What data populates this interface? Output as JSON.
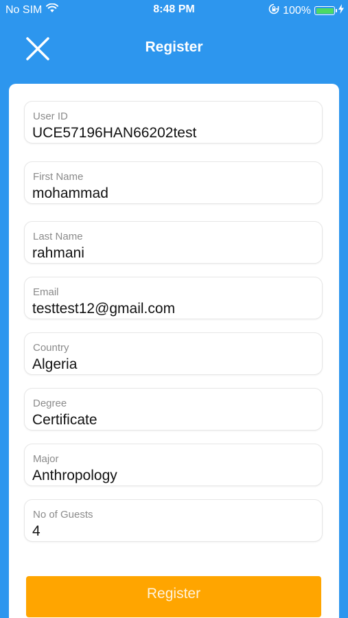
{
  "status_bar": {
    "carrier": "No SIM",
    "time": "8:48 PM",
    "battery_percent": "100%",
    "battery_level": 1.0,
    "battery_color": "#4cd964",
    "icons": [
      "wifi-icon",
      "rotation-lock-icon",
      "battery-icon",
      "charging-bolt-icon"
    ]
  },
  "nav": {
    "title": "Register",
    "close_icon": "close-icon",
    "background": "#2d96ee"
  },
  "form": {
    "fields": [
      {
        "label": "User ID",
        "value": "UCE57196HAN66202test"
      },
      {
        "label": "First Name",
        "value": "mohammad"
      },
      {
        "label": "Last Name",
        "value": "rahmani"
      },
      {
        "label": "Email",
        "value": "testtest12@gmail.com"
      },
      {
        "label": "Country",
        "value": "Algeria"
      },
      {
        "label": "Degree",
        "value": "Certificate"
      },
      {
        "label": "Major",
        "value": "Anthropology"
      },
      {
        "label": "No of Guests",
        "value": "4"
      }
    ],
    "submit_label": "Register",
    "submit_color": "#ffa500"
  }
}
